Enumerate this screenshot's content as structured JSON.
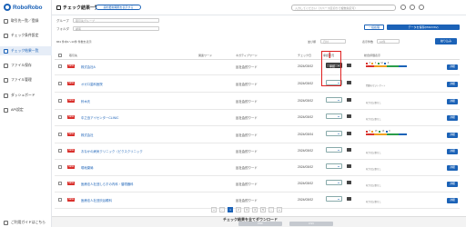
{
  "app": {
    "logo": "RoboRobo"
  },
  "sidebar": {
    "items": [
      {
        "label": "取引先一覧／登録"
      },
      {
        "label": "チェック条件設定"
      },
      {
        "label": "チェック結果一覧"
      },
      {
        "label": "ファイル保存"
      },
      {
        "label": "ファイル管理"
      },
      {
        "label": "ダッシュボード"
      },
      {
        "label": "API設定"
      }
    ],
    "bottom": "ご利用ガイドはこちら"
  },
  "header": {
    "title": "チェック結果一覧",
    "badge": "契約更新期限を表示する",
    "search_placeholder": "入力してください（スペース区切りで複数指定可）"
  },
  "filters": {
    "group_label": "グループ",
    "group_value": "取引先グループ",
    "folder_label": "フォルダ",
    "folder_value": "顧客",
    "all_button": "一括処理",
    "export_button": "データを保存(PDF/CSV)",
    "count_text": "863 件中1〜10件 件数を表示",
    "sort_label": "並び順",
    "sort_value": "日付",
    "per_page_label": "表示件数",
    "per_page_value": "10件",
    "narrow_button": "絞り込み"
  },
  "table": {
    "headers": [
      "取引先",
      "関連ワード",
      "ネガティブワード",
      "チェック日",
      "承認状況",
      "総合評価表示"
    ],
    "rows": [
      {
        "new": "NEW",
        "name": "株式会社A",
        "word": "反社会的ワード",
        "date": "2024/03/02",
        "status": "承認",
        "gauge": [
          "3",
          "4",
          "12",
          "6"
        ],
        "detail": "詳細"
      },
      {
        "new": "NEW",
        "name": "オガロ歯科医院",
        "word": "反社会的ワード",
        "date": "2024/03/02",
        "status": "",
        "gauge_text": "問題のないレポート",
        "detail": "詳細"
      },
      {
        "new": "NEW",
        "name": "鈴木氏",
        "word": "反社会的ワード",
        "date": "2024/03/02",
        "status": "",
        "gauge_text": "有力な記事なし",
        "detail": "詳細"
      },
      {
        "new": "NEW",
        "name": "中之島アイセンターCLINIC",
        "word": "反社会的ワード",
        "date": "2024/03/02",
        "status": "",
        "gauge_text": "有力な記事なし",
        "detail": "詳細"
      },
      {
        "new": "NEW",
        "name": "株式会社",
        "word": "反社会的ワード",
        "date": "2024/03/04",
        "status": "",
        "gauge": [
          "5",
          "15",
          "13",
          "8"
        ],
        "detail": "詳細"
      },
      {
        "new": "NEW",
        "name": "おなかの病気クリニック（ピクスクリニック",
        "word": "反社会的ワード",
        "date": "2024/03/02",
        "status": "",
        "gauge_text": "有力な記事なし",
        "detail": "詳細"
      },
      {
        "new": "NEW",
        "name": "現地薬局",
        "word": "反社会的ワード",
        "date": "2024/03/02",
        "status": "",
        "gauge_text": "有力な記事なし",
        "detail": "詳細"
      },
      {
        "new": "NEW",
        "name": "医療法人社団しらすの内科・循環器科",
        "word": "反社会的ワード",
        "date": "2024/03/02",
        "status": "",
        "gauge_text": "有力な記事なし",
        "detail": "詳細"
      },
      {
        "new": "NEW",
        "name": "医療法人社団渋谷眼科",
        "word": "反社会的ワード",
        "date": "2024/03/02",
        "status": "",
        "gauge_text": "有力な記事なし",
        "detail": "詳細"
      }
    ]
  },
  "pagination": [
    "«",
    "‹",
    "1",
    "2",
    "3",
    "4",
    "5",
    "›",
    "»"
  ],
  "footer": {
    "title": "チェック結果を全てダウンロード",
    "btn1": "PDF",
    "btn2": "CSV"
  }
}
